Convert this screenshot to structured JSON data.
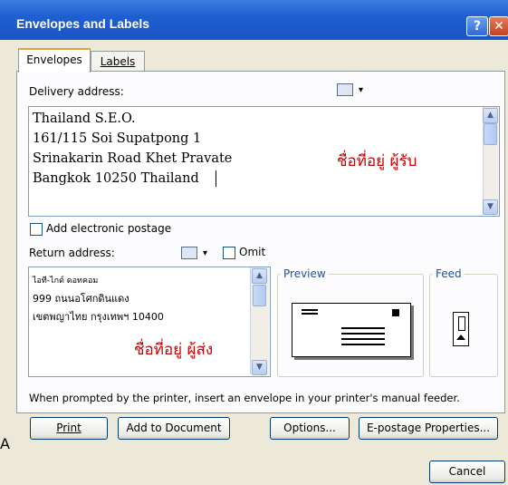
{
  "window": {
    "title": "Envelopes and Labels",
    "help_glyph": "?",
    "close_glyph": "✕"
  },
  "tabs": [
    {
      "label": "Envelopes",
      "active": true
    },
    {
      "label": "Labels",
      "active": false
    }
  ],
  "delivery": {
    "label": "Delivery address:",
    "lines": [
      "Thailand S.E.O.",
      "161/115 Soi Supatpong 1",
      "Srinakarin Road Khet Pravate",
      "Bangkok 10250 Thailand"
    ],
    "annotation": "ชื่อที่อยู่ ผู้รับ"
  },
  "electronic_postage": {
    "label": "Add electronic postage",
    "checked": false
  },
  "return": {
    "label": "Return address:",
    "omit_label": "Omit",
    "omit_checked": false,
    "lines": [
      "ไอที-ไกด์ ดอทคอม",
      "999 ถนนอโศกดินแดง",
      "เขตพญาไทย กรุงเทพฯ 10400"
    ],
    "annotation": "ชื่อที่อยู่ ผู้ส่ง"
  },
  "preview": {
    "label": "Preview"
  },
  "feed": {
    "label": "Feed"
  },
  "hint": "When prompted by the printer, insert an envelope in your printer's manual feeder.",
  "buttons": {
    "print": "Print",
    "add_to_document": "Add to Document",
    "options": "Options...",
    "epostage": "E-postage Properties...",
    "cancel": "Cancel"
  },
  "stray_text": "A",
  "icons": {
    "address_book": "address-book-icon",
    "dropdown": "▾"
  }
}
